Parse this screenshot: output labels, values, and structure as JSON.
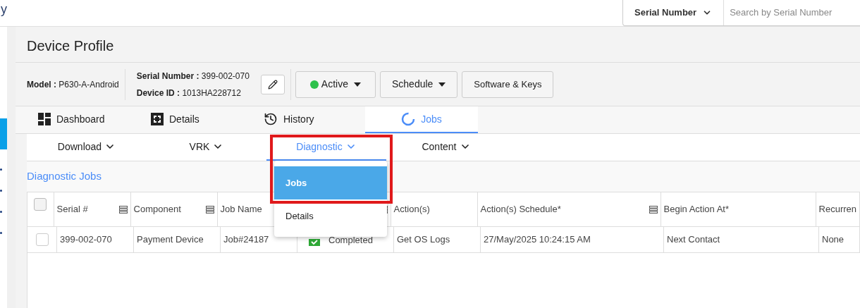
{
  "header": {
    "title_fragment": "y",
    "search": {
      "field_label": "Serial Number",
      "placeholder": "Search by Serial Number"
    }
  },
  "page_title": "Device Profile",
  "device_info": {
    "model_label": "Model :",
    "model": "P630-A-Android",
    "serial_label": "Serial Number :",
    "serial": "399-002-070",
    "device_id_label": "Device ID :",
    "device_id": "1013HA228712"
  },
  "actions": [
    {
      "kind": "status",
      "label": "Active"
    },
    {
      "kind": "dropdown",
      "label": "Schedule"
    },
    {
      "kind": "button",
      "label": "Software & Keys"
    }
  ],
  "tabs": [
    {
      "label": "Dashboard",
      "selected": false
    },
    {
      "label": "Details",
      "selected": false
    },
    {
      "label": "History",
      "selected": false
    },
    {
      "label": "Jobs",
      "selected": true
    }
  ],
  "subtabs": [
    {
      "label": "Download",
      "selected": false
    },
    {
      "label": "VRK",
      "selected": false
    },
    {
      "label": "Diagnostic",
      "selected": true
    },
    {
      "label": "Content",
      "selected": false
    }
  ],
  "dropdown": {
    "items": [
      {
        "label": "Jobs",
        "selected": true
      },
      {
        "label": "Details",
        "selected": false
      }
    ]
  },
  "section_title": "Diagnostic Jobs",
  "table": {
    "header_checked": false,
    "columns": [
      {
        "label": "Serial #",
        "filter_icon": true
      },
      {
        "label": "Component",
        "filter_icon": true
      },
      {
        "label": "Job Name"
      },
      {
        "filter_icon": true
      },
      {
        "label": "Action(s)",
        "filter_icon": false
      },
      {
        "label": "Action(s) Schedule*",
        "filter_icon": true
      },
      {
        "label": "Begin Action At*",
        "filter_icon": false
      },
      {
        "label": "Recurren",
        "filter_icon": false
      }
    ],
    "rows": [
      {
        "checked": false,
        "cells": [
          "399-002-070",
          "Payment Device",
          "Job#24187",
          "Completed",
          "Get OS Logs",
          "27/May/2025 10:24:15 AM",
          "Next Contact",
          "None"
        ]
      }
    ]
  }
}
